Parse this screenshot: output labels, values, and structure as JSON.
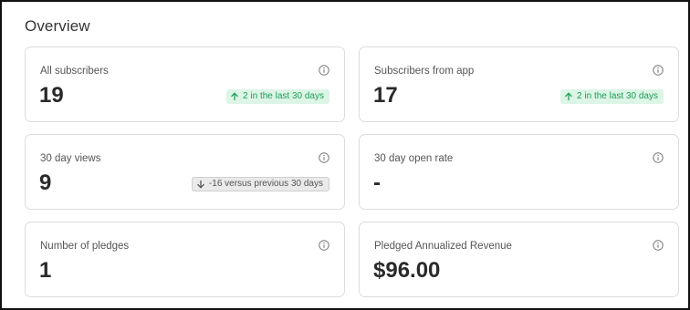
{
  "overview": {
    "title": "Overview"
  },
  "cards": [
    {
      "label": "All subscribers",
      "value": "19",
      "badge": {
        "direction": "up",
        "text": "2 in the last 30 days",
        "icon": "arrow-up-icon"
      }
    },
    {
      "label": "Subscribers from app",
      "value": "17",
      "badge": {
        "direction": "up",
        "text": "2 in the last 30 days",
        "icon": "arrow-up-icon"
      }
    },
    {
      "label": "30 day views",
      "value": "9",
      "badge": {
        "direction": "down",
        "text": "-16 versus previous 30 days",
        "icon": "arrow-down-icon"
      }
    },
    {
      "label": "30 day open rate",
      "value": "-"
    },
    {
      "label": "Number of pledges",
      "value": "1"
    },
    {
      "label": "Pledged Annualized Revenue",
      "value": "$96.00"
    }
  ],
  "icons": {
    "info": "info-icon"
  },
  "colors": {
    "badge_up_bg": "#dcf5e6",
    "badge_up_text": "#1f9d5a",
    "badge_down_bg": "#eaeaea",
    "badge_down_text": "#555555"
  }
}
